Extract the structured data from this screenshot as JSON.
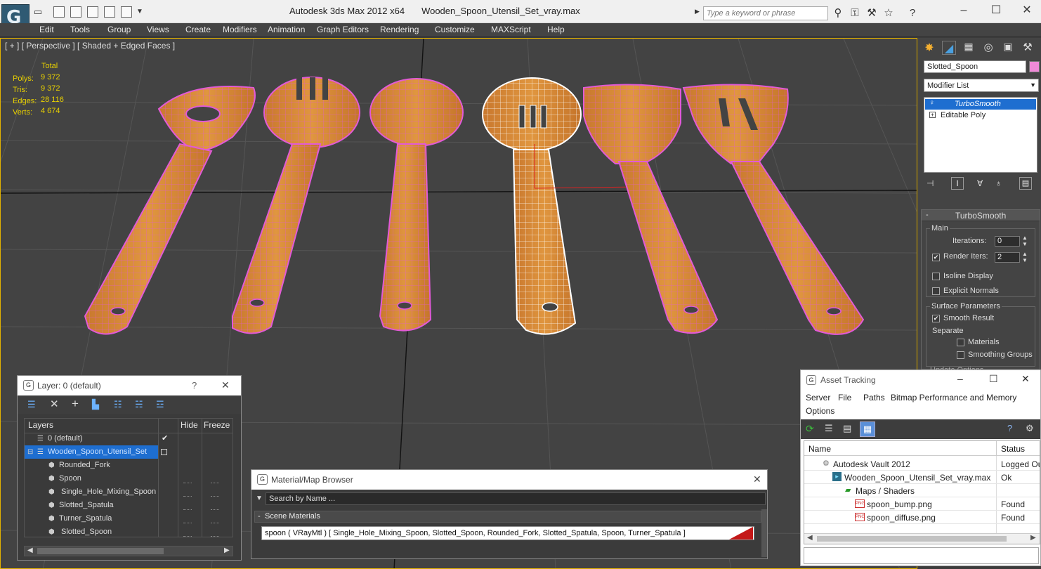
{
  "app": {
    "title": "Autodesk 3ds Max  2012 x64",
    "filename": "Wooden_Spoon_Utensil_Set_vray.max",
    "search_placeholder": "Type a keyword or phrase"
  },
  "menu": [
    "Edit",
    "Tools",
    "Group",
    "Views",
    "Create",
    "Modifiers",
    "Animation",
    "Graph Editors",
    "Rendering",
    "Customize",
    "MAXScript",
    "Help"
  ],
  "viewport": {
    "label": "[ + ] [ Perspective ] [ Shaded + Edged Faces ]",
    "stats_header": "Total",
    "stats": [
      {
        "label": "Polys:",
        "value": "9 372"
      },
      {
        "label": "Tris:",
        "value": "9 372"
      },
      {
        "label": "Edges:",
        "value": "28 116"
      },
      {
        "label": "Verts:",
        "value": "4 674"
      }
    ]
  },
  "command_panel": {
    "object_name": "Slotted_Spoon",
    "modifier_list": "Modifier List",
    "stack": [
      {
        "label": "TurboSmooth",
        "selected": true
      },
      {
        "label": "Editable Poly",
        "selected": false
      }
    ],
    "rollout_title": "TurboSmooth",
    "main_group": "Main",
    "iterations_label": "Iterations:",
    "iterations_value": "0",
    "render_iters_label": "Render Iters:",
    "render_iters_value": "2",
    "isoline_label": "Isoline Display",
    "explicit_normals_label": "Explicit Normals",
    "surface_group": "Surface Parameters",
    "smooth_result_label": "Smooth Result",
    "separate_label": "Separate",
    "materials_label": "Materials",
    "smoothing_groups_label": "Smoothing Groups",
    "update_options": "Update Options"
  },
  "layer_window": {
    "title": "Layer: 0 (default)",
    "help": "?",
    "close": "✕",
    "columns": [
      "Layers",
      "Hide",
      "Freeze"
    ],
    "rows": [
      {
        "label": "0 (default)",
        "level": 0,
        "selected": false
      },
      {
        "label": "Wooden_Spoon_Utensil_Set",
        "level": 0,
        "selected": true
      },
      {
        "label": "Rounded_Fork",
        "level": 1,
        "selected": false
      },
      {
        "label": "Spoon",
        "level": 1,
        "selected": false
      },
      {
        "label": "Single_Hole_Mixing_Spoon",
        "level": 1,
        "selected": false
      },
      {
        "label": "Slotted_Spatula",
        "level": 1,
        "selected": false
      },
      {
        "label": "Turner_Spatula",
        "level": 1,
        "selected": false
      },
      {
        "label": "Slotted_Spoon",
        "level": 1,
        "selected": false
      }
    ]
  },
  "material_browser": {
    "title": "Material/Map Browser",
    "search_placeholder": "Search by Name ...",
    "section": "Scene Materials",
    "material": "spoon  ( VRayMtl )  [ Single_Hole_Mixing_Spoon,  Slotted_Spoon, Rounded_Fork, Slotted_Spatula, Spoon, Turner_Spatula ]"
  },
  "asset_tracking": {
    "title": "Asset Tracking",
    "menu": [
      "Server",
      "File",
      "Paths",
      "Bitmap Performance and Memory",
      "Options"
    ],
    "columns": [
      "Name",
      "Status"
    ],
    "rows": [
      {
        "name": "Autodesk Vault 2012",
        "status": "Logged Ou",
        "level": 0
      },
      {
        "name": "Wooden_Spoon_Utensil_Set_vray.max",
        "status": "Ok",
        "level": 1
      },
      {
        "name": "Maps / Shaders",
        "status": "",
        "level": 2
      },
      {
        "name": "spoon_bump.png",
        "status": "Found",
        "level": 3
      },
      {
        "name": "spoon_diffuse.png",
        "status": "Found",
        "level": 3
      }
    ]
  },
  "colors": {
    "viewport_bg": "#434343",
    "wood": "#d98a3a",
    "wire_pink": "#e25ad6",
    "selection_blue": "#1e6ed0",
    "stats_yellow": "#e8d000"
  }
}
